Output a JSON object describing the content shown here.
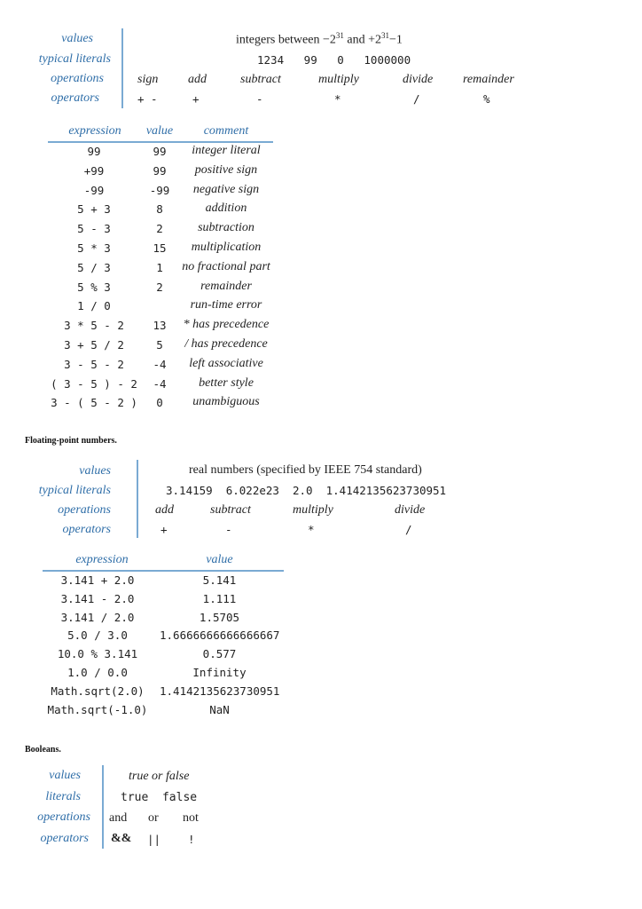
{
  "int_summary": {
    "labels": [
      "values",
      "typical literals",
      "operations",
      "operators"
    ],
    "values_text": "integers between",
    "values_min": "−2",
    "values_min_exp": "31",
    "values_and": "and",
    "values_max": "+2",
    "values_max_exp": "31",
    "values_max_suffix": "−1",
    "literals": "1234   99   0   1000000",
    "operations": [
      "sign",
      "add",
      "subtract",
      "multiply",
      "divide",
      "remainder"
    ],
    "operators": [
      "+ -",
      "+",
      "-",
      "*",
      "/",
      "%"
    ]
  },
  "int_table": {
    "headers": [
      "expression",
      "value",
      "comment"
    ],
    "rows": [
      {
        "expr": "99",
        "value": "99",
        "comment": "integer literal"
      },
      {
        "expr": "+99",
        "value": "99",
        "comment": "positive sign"
      },
      {
        "expr": "-99",
        "value": "-99",
        "comment": "negative sign"
      },
      {
        "expr": "5 + 3",
        "value": "8",
        "comment": "addition"
      },
      {
        "expr": "5 - 3",
        "value": "2",
        "comment": "subtraction"
      },
      {
        "expr": "5 * 3",
        "value": "15",
        "comment": "multiplication"
      },
      {
        "expr": "5 / 3",
        "value": "1",
        "comment": "no fractional part"
      },
      {
        "expr": "5 % 3",
        "value": "2",
        "comment": "remainder"
      },
      {
        "expr": "1 / 0",
        "value": "",
        "comment": "run-time error"
      },
      {
        "expr": "3 * 5 - 2",
        "value": "13",
        "comment": "* has precedence"
      },
      {
        "expr": "3 + 5 / 2",
        "value": "5",
        "comment": "/ has precedence"
      },
      {
        "expr": "3 - 5 - 2",
        "value": "-4",
        "comment": "left associative"
      },
      {
        "expr": "( 3 - 5 ) - 2",
        "value": "-4",
        "comment": "better style"
      },
      {
        "expr": "3 - ( 5 - 2 )",
        "value": "0",
        "comment": "unambiguous"
      }
    ]
  },
  "float_section_title": "Floating-point numbers.",
  "float_summary": {
    "labels": [
      "values",
      "typical literals",
      "operations",
      "operators"
    ],
    "values_text": "real numbers (specified by IEEE 754 standard)",
    "literals": "3.14159  6.022e23  2.0  1.4142135623730951",
    "operations": [
      "add",
      "subtract",
      "multiply",
      "divide"
    ],
    "operators": [
      "+",
      "-",
      "*",
      "/"
    ]
  },
  "float_table": {
    "headers": [
      "expression",
      "value"
    ],
    "rows": [
      {
        "expr": "3.141 + 2.0",
        "value": "5.141"
      },
      {
        "expr": "3.141 - 2.0",
        "value": "1.111"
      },
      {
        "expr": "3.141 / 2.0",
        "value": "1.5705"
      },
      {
        "expr": "5.0 / 3.0",
        "value": "1.6666666666666667"
      },
      {
        "expr": "10.0 % 3.141",
        "value": "0.577"
      },
      {
        "expr": "1.0 / 0.0",
        "value": "Infinity"
      },
      {
        "expr": "Math.sqrt(2.0)",
        "value": "1.4142135623730951"
      },
      {
        "expr": "Math.sqrt(-1.0)",
        "value": "NaN"
      }
    ]
  },
  "bool_section_title": "Booleans.",
  "bool_summary": {
    "labels": [
      "values",
      "literals",
      "operations",
      "operators"
    ],
    "values_text": "true or false",
    "literals": "true  false",
    "operations": [
      "and",
      "or",
      "not"
    ],
    "operators": [
      "&&",
      "||",
      "!"
    ]
  }
}
